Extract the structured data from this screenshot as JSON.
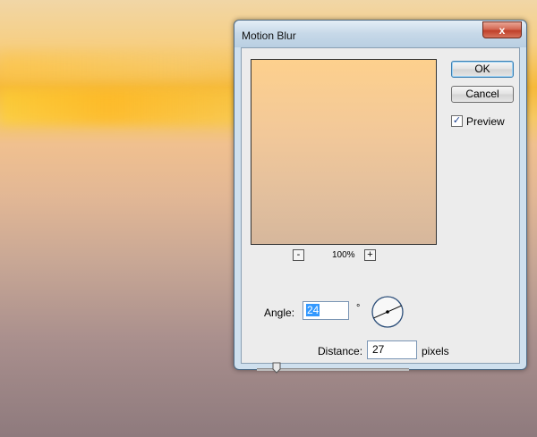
{
  "dialog": {
    "title": "Motion Blur",
    "close_label": "x"
  },
  "preview": {
    "zoom_out_label": "-",
    "zoom_level": "100%",
    "zoom_in_label": "+"
  },
  "buttons": {
    "ok_label": "OK",
    "cancel_label": "Cancel"
  },
  "preview_checkbox": {
    "label": "Preview",
    "checked": true,
    "check_glyph": "✓"
  },
  "angle": {
    "label": "Angle:",
    "value": "24",
    "unit": "°"
  },
  "distance": {
    "label": "Distance:",
    "value": "27",
    "unit": "pixels",
    "slider_fraction": 0.07
  },
  "icons": {
    "angle_dial": "angle-dial-icon",
    "slider_thumb": "slider-thumb-icon"
  },
  "colors": {
    "selection": "#3399ff",
    "close_button": "#c0402a",
    "dialog_frame": "#cfe0ee"
  }
}
